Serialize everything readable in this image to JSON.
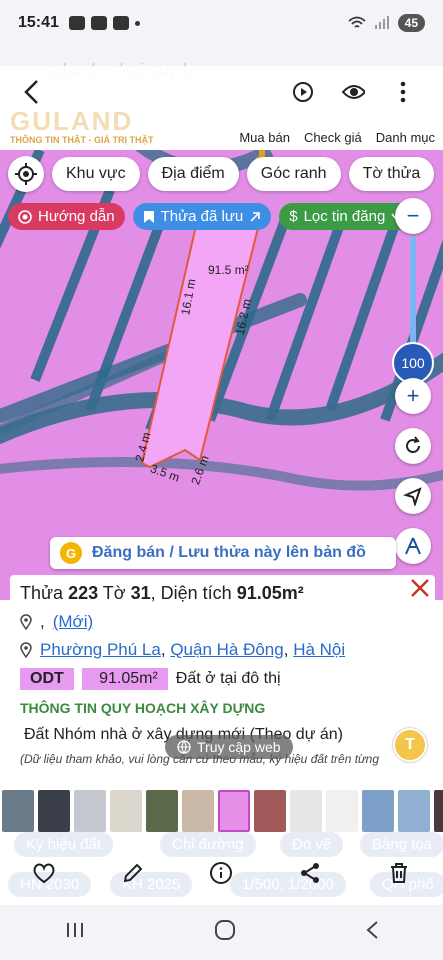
{
  "status": {
    "time": "15:41",
    "battery": "45"
  },
  "browser": {
    "url": "guland.vn/soi-quy-h"
  },
  "header": {
    "brand": "GULAND",
    "tagline": "THÔNG TIN THẬT - GIÁ TRỊ THẬT",
    "nav": [
      "Mua bán",
      "Check giá",
      "Danh mục"
    ]
  },
  "filters": {
    "chips": [
      "Khu vực",
      "Địa điểm",
      "Góc ranh",
      "Tờ thửa"
    ],
    "guide": "Hướng dẫn",
    "saved": "Thửa đã lưu",
    "listing_filter": "Lọc tin đăng"
  },
  "zoom": {
    "value": "100"
  },
  "parcel": {
    "area_label": "91.5 m²",
    "edges": [
      "16.1 m",
      "16.2 m",
      "2.4 m",
      "3.5 m",
      "2.6 m"
    ]
  },
  "banner": {
    "text": "Đăng bán / Lưu thửa này lên bản đồ"
  },
  "panel": {
    "title_pre": "Thửa ",
    "plot_no": "223",
    "title_mid": " Tờ ",
    "sheet_no": "31",
    "title_area_pre": ", Diện tích ",
    "area": "91.05m²",
    "address_short_sep": ",",
    "address_new": "(Mới)",
    "ward": "Phường Phú La",
    "district": "Quận Hà Đông",
    "city": "Hà Nội",
    "sep": ",",
    "land_code": "ODT",
    "land_area": "91.05m²",
    "land_desc": "Đất ở tại đô thị",
    "section_title": "THÔNG TIN QUY HOẠCH XÂY DỰNG",
    "planning_type": "Đất Nhóm nhà ở xây dựng mới (Theo dự án)",
    "note": "(Dữ liệu tham khảo, vui lòng căn cứ theo mẫu, ký hiệu đất trên từng",
    "web_access": "Truy cập web",
    "t_button": "T"
  },
  "ghost_chips": [
    "Ký hiệu đất",
    "Chỉ đường",
    "Đo vẽ",
    "Bảng tọa",
    "HN 2030",
    "KH 2025",
    "1/500, 1/2000",
    "QH phố"
  ],
  "colors": {
    "map_pink": "#e28ee6",
    "red": "#d83a62",
    "blue": "#3f8ee6",
    "green": "#3c9b45"
  }
}
